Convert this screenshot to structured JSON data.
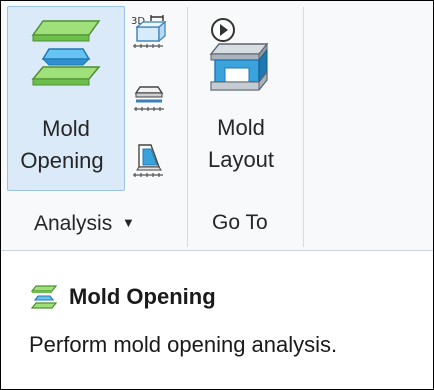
{
  "ribbon": {
    "mold_opening": {
      "line1": "Mold",
      "line2": "Opening",
      "icon": "mold-opening-icon"
    },
    "small_tools": [
      {
        "icon": "3d-measure-icon"
      },
      {
        "icon": "interference-check-icon"
      },
      {
        "icon": "draft-check-icon"
      }
    ],
    "mold_layout": {
      "line1": "Mold",
      "line2": "Layout",
      "icon": "mold-layout-icon"
    },
    "groups": {
      "analysis": "Analysis",
      "goto": "Go To"
    },
    "dropdown_glyph": "▼"
  },
  "tooltip": {
    "title": "Mold Opening",
    "description": "Perform mold opening analysis."
  },
  "colors": {
    "active_bg": "#dbeaf8",
    "active_border": "#9cc3e6",
    "green": "#8fd36a",
    "blue": "#3aa3dc"
  }
}
